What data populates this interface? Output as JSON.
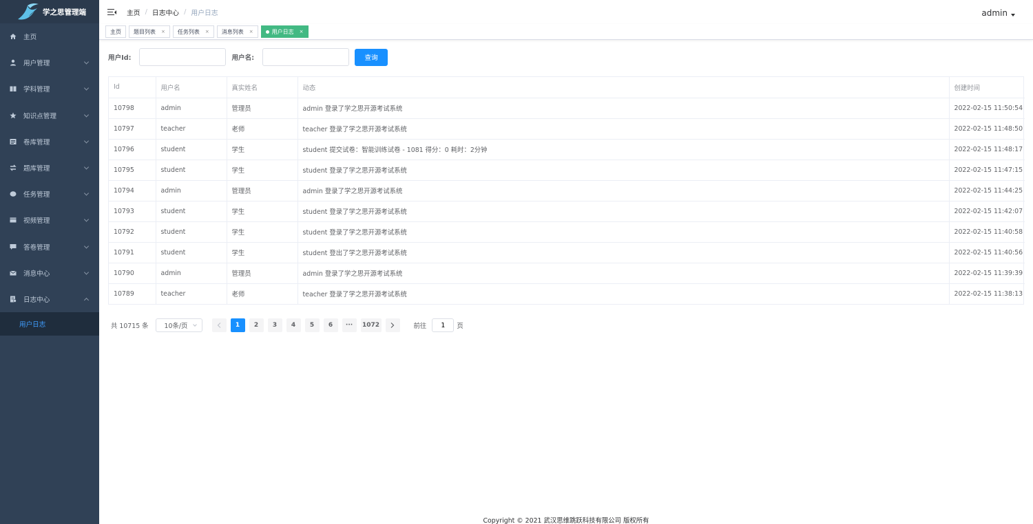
{
  "app": {
    "title": "学之思管理端"
  },
  "sidebar": {
    "items": [
      {
        "label": "主页",
        "icon": "home-icon",
        "expandable": false
      },
      {
        "label": "用户管理",
        "icon": "user-icon",
        "expandable": true
      },
      {
        "label": "学科管理",
        "icon": "book-icon",
        "expandable": true
      },
      {
        "label": "知识点管理",
        "icon": "star-icon",
        "expandable": true
      },
      {
        "label": "卷库管理",
        "icon": "paper-icon",
        "expandable": true
      },
      {
        "label": "题库管理",
        "icon": "exchange-icon",
        "expandable": true
      },
      {
        "label": "任务管理",
        "icon": "chat-icon",
        "expandable": true
      },
      {
        "label": "视频管理",
        "icon": "video-icon",
        "expandable": true
      },
      {
        "label": "答卷管理",
        "icon": "message-icon",
        "expandable": true
      },
      {
        "label": "消息中心",
        "icon": "mail-icon",
        "expandable": true
      },
      {
        "label": "日志中心",
        "icon": "log-icon",
        "expandable": true,
        "expanded": true
      }
    ],
    "submenu": [
      {
        "label": "用户日志",
        "active": true
      }
    ]
  },
  "header": {
    "breadcrumb": [
      "主页",
      "日志中心",
      "用户日志"
    ],
    "user": "admin"
  },
  "tags": [
    {
      "label": "主页",
      "closable": false,
      "active": false
    },
    {
      "label": "题目列表",
      "closable": true,
      "active": false
    },
    {
      "label": "任务列表",
      "closable": true,
      "active": false
    },
    {
      "label": "消息列表",
      "closable": true,
      "active": false
    },
    {
      "label": "用户日志",
      "closable": true,
      "active": true
    }
  ],
  "search": {
    "user_id_label": "用户Id:",
    "user_id_value": "",
    "username_label": "用户名:",
    "username_value": "",
    "query_button": "查询"
  },
  "table": {
    "columns": [
      "Id",
      "用户名",
      "真实姓名",
      "动态",
      "创建时间"
    ],
    "rows": [
      [
        "10798",
        "admin",
        "管理员",
        "admin 登录了学之思开源考试系统",
        "2022-02-15 11:50:54"
      ],
      [
        "10797",
        "teacher",
        "老师",
        "teacher 登录了学之思开源考试系统",
        "2022-02-15 11:48:50"
      ],
      [
        "10796",
        "student",
        "学生",
        "student 提交试卷：智能训练试卷 - 1081 得分：0 耗时：2分钟",
        "2022-02-15 11:48:17"
      ],
      [
        "10795",
        "student",
        "学生",
        "student 登录了学之思开源考试系统",
        "2022-02-15 11:47:15"
      ],
      [
        "10794",
        "admin",
        "管理员",
        "admin 登录了学之思开源考试系统",
        "2022-02-15 11:44:25"
      ],
      [
        "10793",
        "student",
        "学生",
        "student 登录了学之思开源考试系统",
        "2022-02-15 11:42:07"
      ],
      [
        "10792",
        "student",
        "学生",
        "student 登录了学之思开源考试系统",
        "2022-02-15 11:40:58"
      ],
      [
        "10791",
        "student",
        "学生",
        "student 登出了学之思开源考试系统",
        "2022-02-15 11:40:56"
      ],
      [
        "10790",
        "admin",
        "管理员",
        "admin 登录了学之思开源考试系统",
        "2022-02-15 11:39:39"
      ],
      [
        "10789",
        "teacher",
        "老师",
        "teacher 登录了学之思开源考试系统",
        "2022-02-15 11:38:13"
      ]
    ]
  },
  "pagination": {
    "total": "共 10715 条",
    "page_size": "10条/页",
    "pages": [
      "1",
      "2",
      "3",
      "4",
      "5",
      "6",
      "···",
      "1072"
    ],
    "current": "1",
    "goto_prefix": "前往",
    "goto_value": "1",
    "goto_suffix": "页"
  },
  "footer": {
    "text": "Copyright © 2021 武汉思维跳跃科技有限公司 版权所有"
  },
  "colors": {
    "sidebar_bg": "#304156",
    "active_tag": "#42b983",
    "primary": "#1890ff",
    "submenu_active": "#409eff"
  }
}
